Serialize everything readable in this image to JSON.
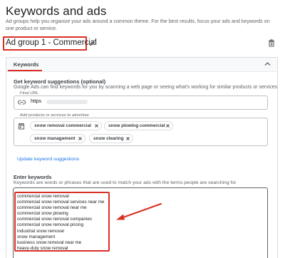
{
  "header": {
    "title": "Keywords and ads",
    "subtitle": "Ad groups help you organize your ads around a common theme. For the best results, focus your ads and keywords on one product or service."
  },
  "ad_group": {
    "name": "Ad group 1 - Commercial"
  },
  "keywords_card": {
    "label": "Keywords"
  },
  "suggestions": {
    "title": "Get keyword suggestions (optional)",
    "description": "Google Ads can find keywords for you by scanning a web page or seeing what's working for similar products or services",
    "final_url_label": "Final URL",
    "final_url_value": "https",
    "products_label": "Add products or services to advertise",
    "chips": [
      "snow removal commercial",
      "snow plowing commercial",
      "snow management",
      "snow clearing"
    ],
    "update_link": "Update keyword suggestions"
  },
  "enter_keywords": {
    "title": "Enter keywords",
    "description": "Keywords are words or phrases that are used to match your ads with the terms people are searching for",
    "keywords": [
      "commercial snow removal",
      "commercial snow removal services near me",
      "commercial snow removal near me",
      "commercial snow plowing",
      "commercial snow removal companies",
      "commercial snow removal pricing",
      "industrial snow removal",
      "snow management",
      "business snow removal near me",
      "heavy-duty snow removal"
    ]
  },
  "colors": {
    "highlight": "#d93025",
    "link": "#1a73e8"
  }
}
